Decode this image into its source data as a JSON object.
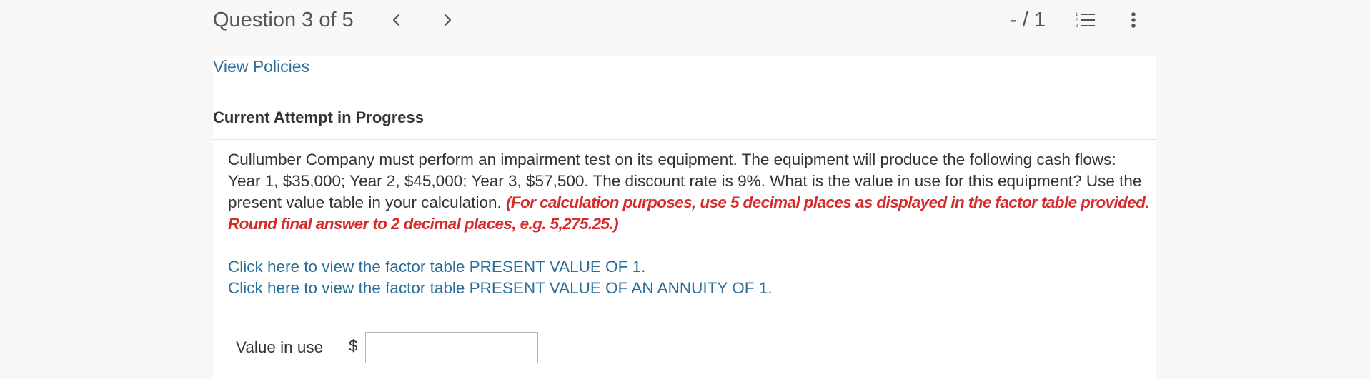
{
  "header": {
    "question_label": "Question 3 of 5",
    "score": "- / 1",
    "icons": {
      "prev": "chevron-left-icon",
      "next": "chevron-right-icon",
      "list": "numbered-list-icon",
      "more": "more-vertical-icon"
    }
  },
  "links": {
    "view_policies": "View Policies"
  },
  "attempt": {
    "heading": "Current Attempt in Progress"
  },
  "question": {
    "body": "Cullumber Company must perform an impairment test on its equipment. The equipment will produce the following cash flows: Year 1, $35,000; Year 2, $45,000; Year 3, $57,500. The discount rate is 9%. What is the value in use for this equipment? Use the present value table in your calculation. ",
    "instruction": "(For calculation purposes, use 5 decimal places as displayed in the factor table provided. Round final answer to 2 decimal places, e.g. 5,275.25.)",
    "table_link_1": "Click here to view the factor table PRESENT VALUE OF 1.",
    "table_link_2": "Click here to view the factor table PRESENT VALUE OF AN ANNUITY OF 1."
  },
  "answer": {
    "label": "Value in use",
    "currency": "$",
    "value": ""
  },
  "colors": {
    "link": "#2a6e99",
    "instruction": "#d52b2b",
    "text": "#333333",
    "background": "#f7f7f7",
    "panel": "#ffffff"
  }
}
